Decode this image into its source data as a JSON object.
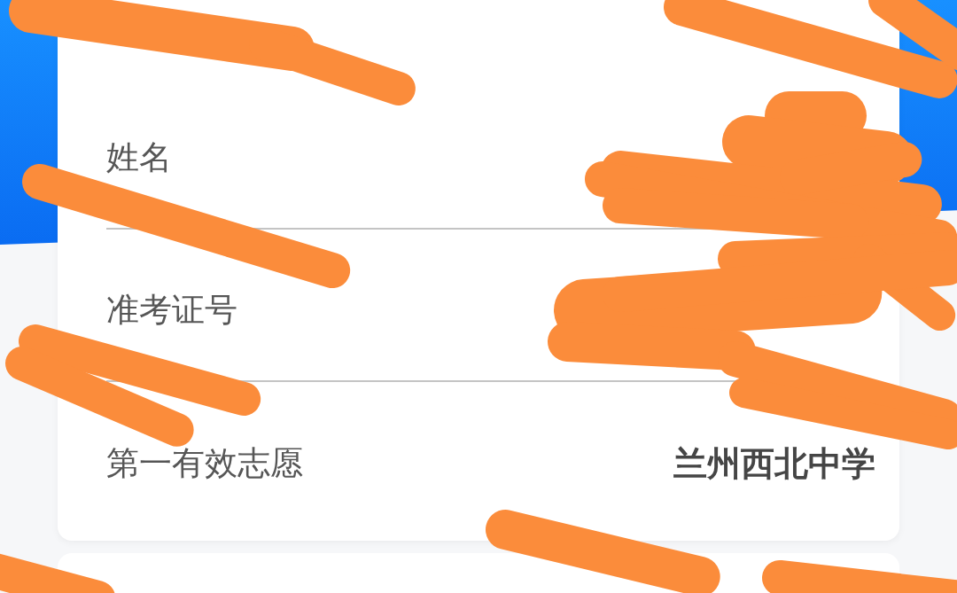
{
  "rows": [
    {
      "label": "姓名"
    },
    {
      "label": "准考证号"
    },
    {
      "label": "第一有效志愿",
      "value": "兰州西北中学"
    }
  ]
}
